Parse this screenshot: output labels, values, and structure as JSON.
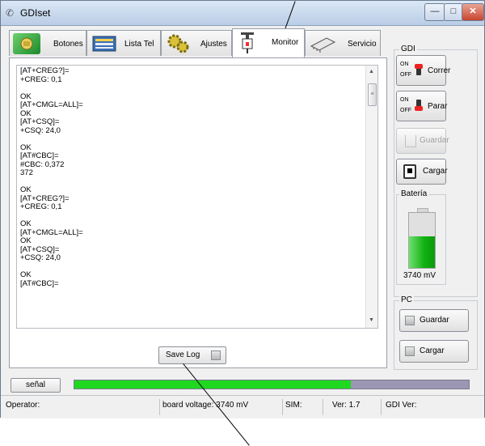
{
  "window": {
    "title": "GDIset"
  },
  "tabs": [
    {
      "label": "Botones",
      "icon": "phone-button-icon",
      "active": false
    },
    {
      "label": "Lista Tel",
      "icon": "address-book-icon",
      "active": false
    },
    {
      "label": "Ajustes",
      "icon": "gears-icon",
      "active": false
    },
    {
      "label": "Monitor",
      "icon": "monitor-probe-icon",
      "active": true
    },
    {
      "label": "Servicio",
      "icon": "chip-icon",
      "active": false
    }
  ],
  "log": {
    "text": "[AT+CREG?]=\n+CREG: 0,1\n\nOK\n[AT+CMGL=ALL]=\nOK\n[AT+CSQ]=\n+CSQ: 24,0\n\nOK\n[AT#CBC]=\n#CBC: 0,372\n372\n\nOK\n[AT+CREG?]=\n+CREG: 0,1\n\nOK\n[AT+CMGL=ALL]=\nOK\n[AT+CSQ]=\n+CSQ: 24,0\n\nOK\n[AT#CBC]=",
    "save_label": "Save Log"
  },
  "gdi": {
    "title": "GDI",
    "on": "ON",
    "off": "OFF",
    "run_label": "Correr",
    "stop_label": "Parar",
    "save_label": "Guardar",
    "load_label": "Cargar"
  },
  "battery": {
    "title": "Batería",
    "voltage": "3740 mV",
    "level": 0.58
  },
  "pc": {
    "title": "PC",
    "save_label": "Guardar",
    "load_label": "Cargar"
  },
  "signal": {
    "label": "señal",
    "level": 0.7
  },
  "status": {
    "operator": "Operator:",
    "board_voltage": "board voltage: 3740 mV",
    "sim": "SIM:",
    "ver": "Ver: 1.7",
    "gdi_ver": "GDI Ver:"
  },
  "colors": {
    "signal_fill": "#1fd81f",
    "signal_track": "#9a96b4",
    "battery_fill": "#10b010",
    "switch_knob": "#e22222"
  }
}
